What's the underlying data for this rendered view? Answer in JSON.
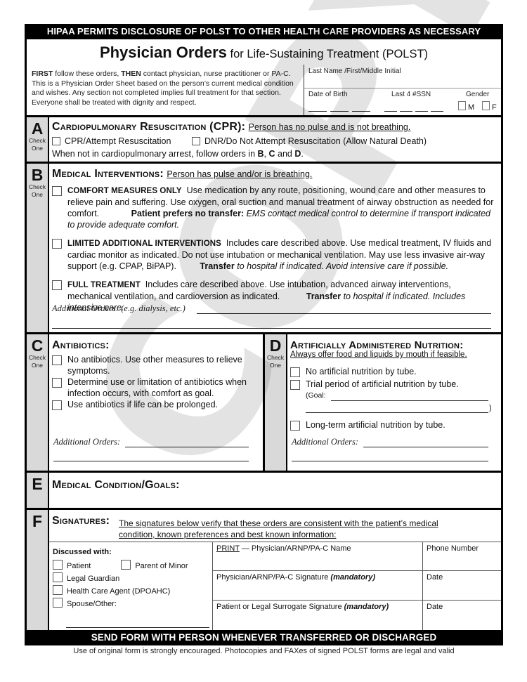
{
  "top_banner": "HIPAA PERMITS DISCLOSURE OF POLST TO OTHER HEALTH CARE PROVIDERS AS NECESSARY",
  "header": {
    "title_bold": "Physician Orders",
    "title_rest": " for Life-Sustaining Treatment (POLST)",
    "intro_first": "FIRST",
    "intro_mid1": " follow these orders, ",
    "intro_then": "THEN",
    "intro_rest": " contact physician, nurse practitioner or PA-C. This is a Physician Order Sheet based on the person’s current medical condition and wishes. Any section not completed implies full treatment for that section. Everyone shall be treated with dignity and respect.",
    "name_label": "Last Name /First/Middle Initial",
    "dob_label": "Date of Birth",
    "ssn_label": "Last 4 #SSN",
    "gender_label": "Gender",
    "gender_m": "M",
    "gender_f": "F"
  },
  "watermark": "COPY",
  "check_one": [
    "Check",
    "One"
  ],
  "section_a": {
    "letter": "A",
    "title": "Cardiopulmonary Resuscitation (CPR):",
    "subtitle": "Person has no pulse and is not breathing.",
    "options": [
      "CPR/Attempt Resuscitation",
      "DNR/Do Not Attempt Resuscitation (Allow Natural Death)"
    ],
    "note_pre": "When not in cardiopulmonary arrest, follow orders in ",
    "note_b": "B",
    "note_sep1": ", ",
    "note_c": "C",
    "note_sep2": " and ",
    "note_d": "D",
    "note_end": "."
  },
  "section_b": {
    "letter": "B",
    "title": "Medical Interventions:",
    "subtitle": "Person has pulse and/or is breathing.",
    "options": [
      {
        "label": "COMFORT MEASURES ONLY",
        "text": "Use medication by any route, positioning, wound care and other measures to relieve pain and suffering. Use oxygen, oral suction and manual treatment of airway obstruction as needed for comfort.",
        "transfer_bold": "Patient prefers no transfer:",
        "transfer_italic": " EMS contact medical control to determine if transport indicated to provide adequate comfort."
      },
      {
        "label": "LIMITED ADDITIONAL INTERVENTIONS",
        "text": "Includes care described above. Use medical treatment, IV fluids and cardiac monitor as indicated. Do not use intubation or mechanical ventilation. May use less invasive air-way support (e.g. CPAP, BiPAP).",
        "transfer_bold": "Transfer",
        "transfer_italic": " to hospital if indicated. Avoid intensive care if possible."
      },
      {
        "label": "FULL TREATMENT",
        "text": "Includes care described above. Use intubation, advanced airway interventions, mechanical ventilation, and cardioversion as indicated.",
        "transfer_bold": "Transfer",
        "transfer_italic": " to hospital if indicated. Includes intensive care."
      }
    ],
    "additional_label": "Additional Orders: (e.g. dialysis, etc.)"
  },
  "section_c": {
    "letter": "C",
    "title": "Antibiotics:",
    "options": [
      "No antibiotics. Use other measures to relieve symptoms.",
      "Determine use or limitation of antibiotics when infection occurs, with comfort as goal.",
      "Use antibiotics if life can be prolonged."
    ],
    "additional_label": "Additional Orders:"
  },
  "section_d": {
    "letter": "D",
    "title": "Artificially Administered Nutrition:",
    "subtitle": "Always offer food and liquids by mouth if feasible.",
    "options": [
      "No artificial nutrition by tube.",
      "Trial period of artificial nutrition by tube.",
      "Long-term artificial nutrition by tube."
    ],
    "goal_label": "(Goal:",
    "goal_close": ")",
    "additional_label": "Additional Orders:"
  },
  "section_e": {
    "letter": "E",
    "title": "Medical Condition/Goals:"
  },
  "section_f": {
    "letter": "F",
    "title": "Signatures:",
    "subtitle_line1": "The signatures below verify that these orders are consistent with the patient’s medical",
    "subtitle_line2": "condition, known preferences and best known information:",
    "discussed_label": "Discussed with:",
    "discussed_options": [
      "Patient",
      "Parent of Minor",
      "Legal Guardian",
      "Health Care Agent (DPOAHC)",
      "Spouse/Other:"
    ],
    "print_label": "PRINT",
    "print_rest": " — Physician/ARNP/PA-C Name",
    "phone_label": "Phone Number",
    "phys_sig_label": "Physician/ARNP/PA-C Signature ",
    "patient_sig_label": "Patient or Legal Surrogate Signature ",
    "mandatory": "(mandatory)",
    "date_label": "Date"
  },
  "bottom_banner": "SEND FORM WITH PERSON WHENEVER TRANSFERRED OR DISCHARGED",
  "footer_note": "Use of original form is strongly encouraged. Photocopies and FAXes of signed POLST forms are legal and valid"
}
